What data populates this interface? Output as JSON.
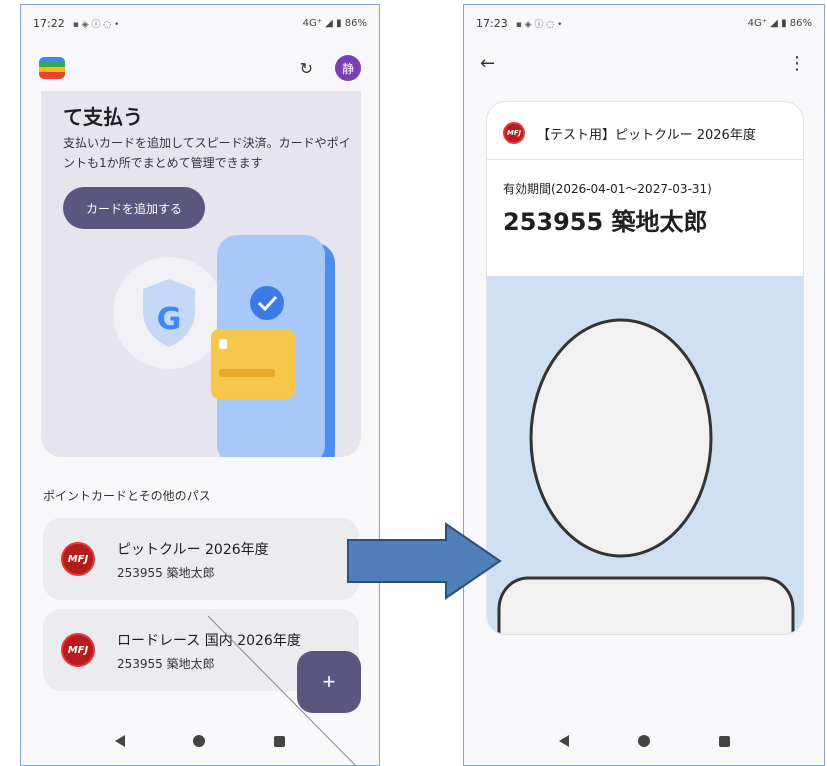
{
  "left_screen": {
    "status": {
      "time": "17:22",
      "network": "4G⁺",
      "battery": "86%"
    },
    "avatar_letter": "静",
    "promo": {
      "title": "て支払う",
      "description": "支払いカードを追加してスピード決済。カードやポイントも1か所でまとめて管理できます",
      "add_card_label": "カードを追加する"
    },
    "section_title": "ポイントカードとその他のパス",
    "passes": [
      {
        "title": "ピットクルー 2026年度",
        "subtitle": "253955 築地太郎"
      },
      {
        "title": "ロードレース 国内 2026年度",
        "subtitle": "253955 築地太郎"
      }
    ],
    "fab_label": "+"
  },
  "right_screen": {
    "status": {
      "time": "17:23",
      "network": "4G⁺",
      "battery": "86%"
    },
    "card": {
      "title": "【テスト用】ピットクルー 2026年度",
      "validity": "有効期間(2026-04-01～2027-03-31)",
      "member": "253955 築地太郎"
    }
  },
  "colors": {
    "accent": "#5a5680",
    "promo_bg": "#e6e5ee",
    "photo_bg": "#cfe0f2",
    "arrow": "#4f7fb8",
    "avatar": "#7b3fb5"
  }
}
